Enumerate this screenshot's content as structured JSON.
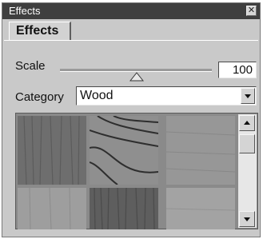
{
  "window": {
    "title": "Effects",
    "close_icon": "close-icon"
  },
  "tabs": [
    {
      "label": "Effects"
    }
  ],
  "scale": {
    "label": "Scale",
    "value": "100",
    "slider_fraction": 0.46
  },
  "category": {
    "label": "Category",
    "value": "Wood"
  },
  "gallery": {
    "icons": {
      "scroll_up": "triangle-up-icon",
      "scroll_down": "triangle-down-icon"
    }
  },
  "colors": {
    "titlebar": "#3f3f3f",
    "panel": "#c9c9c9"
  }
}
